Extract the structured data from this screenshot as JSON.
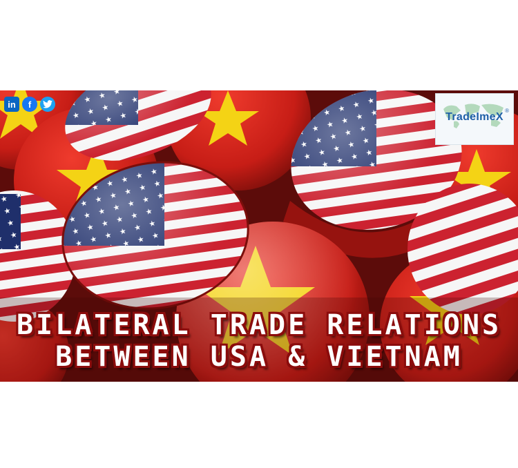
{
  "social": {
    "linkedin": {
      "icon": "linkedin-icon",
      "glyph": "in"
    },
    "facebook": {
      "icon": "facebook-icon",
      "glyph": "f"
    },
    "twitter": {
      "icon": "twitter-icon",
      "glyph": "t"
    }
  },
  "logo": {
    "brand": "TradeImeX",
    "mark": "®"
  },
  "headline": {
    "line1": "BILATERAL TRADE RELATIONS",
    "line2": "BETWEEN USA & VIETNAM"
  },
  "colors": {
    "vietnam_red": "#d2231c",
    "vietnam_star": "#f4d315",
    "usa_red": "#c8202b",
    "usa_blue": "#1f2f6b",
    "title_outline": "#8b0c0c"
  }
}
